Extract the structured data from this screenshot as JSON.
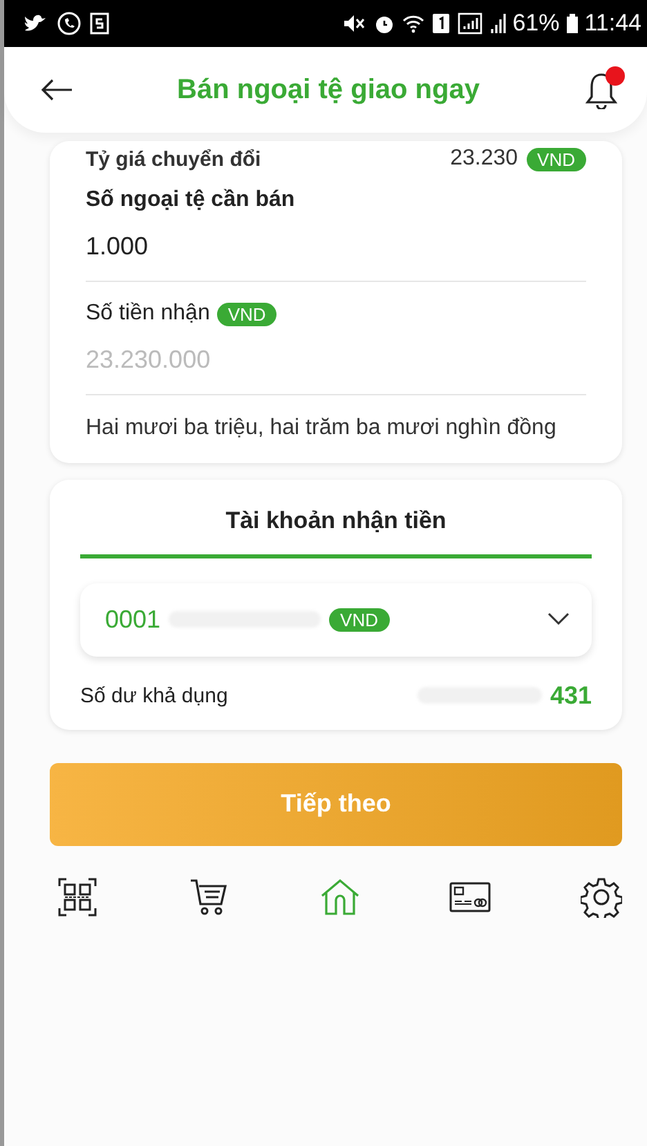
{
  "status_bar": {
    "battery": "61%",
    "time": "11:44"
  },
  "header": {
    "title": "Bán ngoại tệ giao ngay",
    "notification": true
  },
  "rate": {
    "label": "Tỷ giá chuyển đổi",
    "value": "23.230",
    "currency": "VND"
  },
  "amount": {
    "label": "Số ngoại tệ cần bán",
    "value": "1.000"
  },
  "receive": {
    "label": "Số tiền nhận",
    "currency": "VND",
    "placeholder": "23.230.000",
    "in_words": "Hai mươi ba triệu, hai trăm ba mươi nghìn đồng"
  },
  "account": {
    "title": "Tài khoản nhận tiền",
    "number": "0001",
    "currency": "VND",
    "balance_label": "Số dư khả dụng",
    "balance": "431"
  },
  "next_button": "Tiếp theo",
  "nav": [
    {
      "kind": "qr",
      "selected": false
    },
    {
      "kind": "cart",
      "selected": false
    },
    {
      "kind": "home",
      "selected": true
    },
    {
      "kind": "card",
      "selected": false
    },
    {
      "kind": "settings",
      "selected": false
    }
  ]
}
